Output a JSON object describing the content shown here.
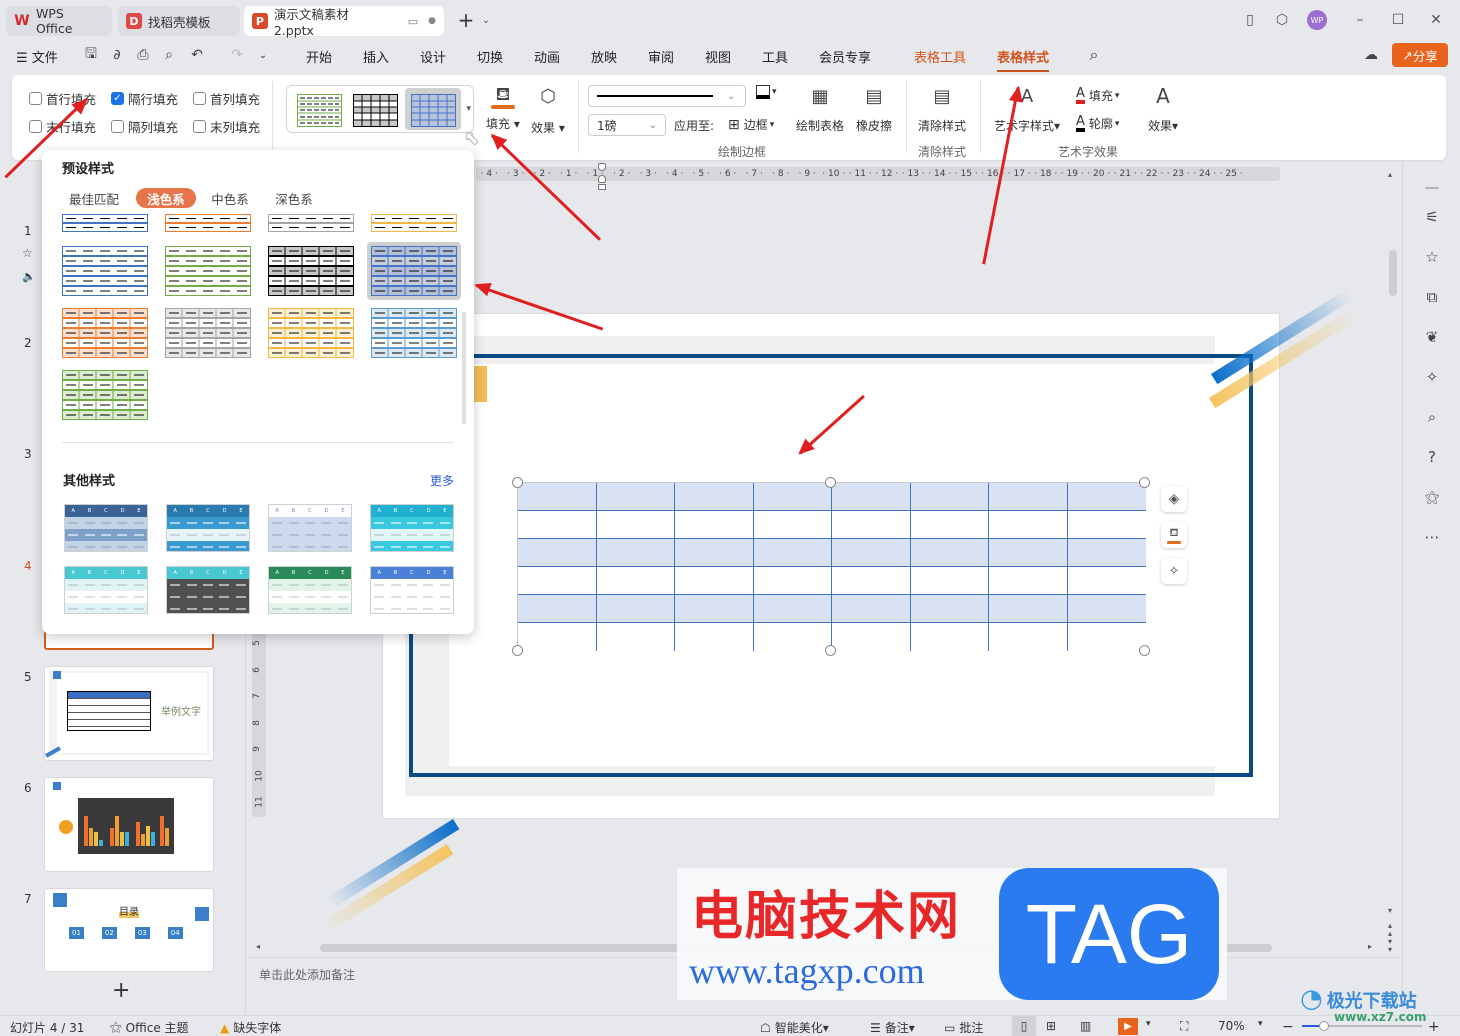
{
  "titlebar": {
    "tabs": [
      {
        "label": "WPS Office",
        "icon": "wps-logo-icon"
      },
      {
        "label": "找稻壳模板",
        "icon": "docer-icon"
      },
      {
        "label": "演示文稿素材2.pptx",
        "icon": "ppt-file-icon",
        "active": true
      }
    ],
    "new_tab": "+",
    "avatar": "WP"
  },
  "menubar": {
    "file": "文件",
    "items": [
      "开始",
      "插入",
      "设计",
      "切换",
      "动画",
      "放映",
      "审阅",
      "视图",
      "工具",
      "会员专享"
    ],
    "context_tabs": [
      "表格工具",
      "表格样式"
    ],
    "active_tab": "表格样式",
    "share": "分享"
  },
  "ribbon": {
    "checkboxes": [
      {
        "label": "首行填充",
        "checked": false
      },
      {
        "label": "隔行填充",
        "checked": true
      },
      {
        "label": "首列填充",
        "checked": false
      },
      {
        "label": "末行填充",
        "checked": false
      },
      {
        "label": "隔列填充",
        "checked": false
      },
      {
        "label": "末列填充",
        "checked": false
      }
    ],
    "fill": "填充",
    "effect": "效果",
    "line_weight": "1磅",
    "apply_to": "应用至:",
    "border": "边框",
    "draw_table": "绘制表格",
    "eraser": "橡皮擦",
    "group_draw_border": "绘制边框",
    "clear_style": "清除样式",
    "group_clear_style": "清除样式",
    "art_style": "艺术字样式",
    "art_fill": "填充",
    "art_outline": "轮廓",
    "art_effect": "效果",
    "group_art": "艺术字效果",
    "colors": {
      "fill_bar": "#e07020",
      "art_fill_bar": "#e02020",
      "accent": "#d0531a"
    }
  },
  "dropdown": {
    "preset_title": "预设样式",
    "tabs": [
      "最佳匹配",
      "浅色系",
      "中色系",
      "深色系"
    ],
    "active_tab": "浅色系",
    "other_title": "其他样式",
    "more": "更多",
    "preset_swatches": [
      {
        "name": "blue-rows",
        "line": "#4472c4",
        "fill": "#ffffff",
        "alt": "#ffffff",
        "grid": false
      },
      {
        "name": "green-rows",
        "line": "#70ad47",
        "fill": "#ffffff",
        "alt": "#ffffff",
        "grid": false
      },
      {
        "name": "black-grid",
        "line": "#000000",
        "fill": "#c8c8c8",
        "alt": "#ffffff",
        "grid": true
      },
      {
        "name": "blue-grid-selected",
        "line": "#4472c4",
        "fill": "#b4c0d8",
        "alt": "#c8cfdc",
        "grid": true
      },
      {
        "name": "orange-grid",
        "line": "#ed7d31",
        "fill": "#fbe0d0",
        "alt": "#ffffff",
        "grid": true
      },
      {
        "name": "gray-grid",
        "line": "#a5a5a5",
        "fill": "#e8e8e8",
        "alt": "#ffffff",
        "grid": true
      },
      {
        "name": "gold-grid",
        "line": "#f4b942",
        "fill": "#fdf0d4",
        "alt": "#ffffff",
        "grid": true
      },
      {
        "name": "lightblue-grid",
        "line": "#5b9bd5",
        "fill": "#dde8f5",
        "alt": "#ffffff",
        "grid": true
      },
      {
        "name": "lightgreen-grid",
        "line": "#70ad47",
        "fill": "#dcecd2",
        "alt": "#ffffff",
        "grid": true
      }
    ],
    "top_partial_colors": [
      "#4472c4",
      "#ed7d31",
      "#a5a5a5",
      "#f4b942"
    ],
    "header_letters": [
      "A",
      "B",
      "C",
      "D",
      "E"
    ],
    "other_swatches": [
      {
        "header": "#3a6496",
        "row1": "#c3d3e6",
        "row2": "#7fa0c8"
      },
      {
        "header": "#2a7ab0",
        "row1": "#3a9ad0",
        "row2": "#e6f3f8"
      },
      {
        "header": "#ffffff",
        "row1": "#ccd9ee",
        "row2": "#ccd9ee"
      },
      {
        "header": "#22b0d0",
        "row1": "#38c8e0",
        "row2": "#e0f6f8"
      },
      {
        "header": "#48c8d0",
        "row1": "#e0f4f6",
        "row2": "#ffffff"
      },
      {
        "header": "#48c8d0",
        "row1": "#505050",
        "row2": "#505050"
      },
      {
        "header": "#2a8a5a",
        "row1": "#e0f4ea",
        "row2": "#ffffff"
      },
      {
        "header": "#4a80d8",
        "row1": "#ffffff",
        "row2": "#ffffff"
      }
    ]
  },
  "slides_panel": {
    "numbers": [
      "1",
      "2",
      "3",
      "4",
      "5",
      "6",
      "7"
    ],
    "current": "4",
    "slide5_text": "举例文字",
    "slide7_title": "目录",
    "slide7_items": [
      "01",
      "02",
      "03",
      "04"
    ],
    "add": "+"
  },
  "ruler": {
    "h_ticks": [
      "4",
      "3",
      "2",
      "1",
      "1",
      "2",
      "3",
      "4",
      "5",
      "6",
      "7",
      "8",
      "9",
      "10",
      "11",
      "12",
      "13",
      "14",
      "15",
      "16",
      "17",
      "18",
      "19",
      "20",
      "21",
      "22",
      "23",
      "24",
      "25"
    ],
    "v_ticks": [
      "5",
      "6",
      "7",
      "8",
      "9",
      "10",
      "11"
    ]
  },
  "table": {
    "rows": 6,
    "cols": 8,
    "band_color": "#d9e2f3",
    "line_color": "#4472c4"
  },
  "notes_placeholder": "单击此处添加备注",
  "statusbar": {
    "slide_info": "幻灯片 4 / 31",
    "theme": "Office 主题",
    "missing_font": "缺失字体",
    "smart_beautify": "智能美化",
    "notes": "备注",
    "comments": "批注",
    "zoom": "70%",
    "zoom_level": 0.7
  },
  "watermark": {
    "title": "电脑技术网",
    "url": "www.tagxp.com",
    "badge": "TAG",
    "site2": "极光下载站",
    "site2_url": "www.xz7.com"
  }
}
